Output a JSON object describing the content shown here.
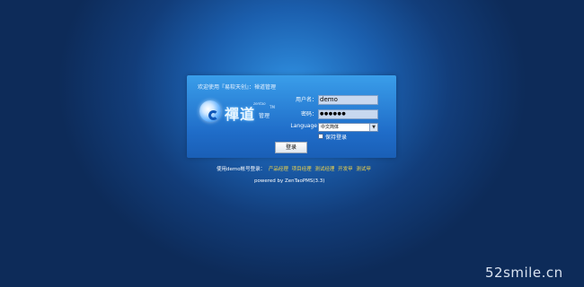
{
  "login": {
    "welcome_text": "欢迎使用『易软天创』：禅道管理",
    "logo": {
      "zh": "禪道",
      "en": "zentao",
      "tm": "TM",
      "sub": "管理"
    },
    "username_label": "用户名：",
    "username_value": "demo",
    "password_label": "密码：",
    "password_value": "●●●●●●",
    "language_label": "Language",
    "language_value": "中文简体",
    "remember_label": "保持登录",
    "login_button": "登录"
  },
  "demo": {
    "prefix": "使用demo帐号登录：",
    "links": [
      "产品经理",
      "项目经理",
      "测试经理",
      "开发甲",
      "测试甲"
    ]
  },
  "powered": "powered by ZenTaoPMS(3.3)",
  "watermark": "52smile.cn",
  "colors": {
    "panel": "#2a7fd8",
    "link": "#f2d54a",
    "background": "#123d7a"
  }
}
